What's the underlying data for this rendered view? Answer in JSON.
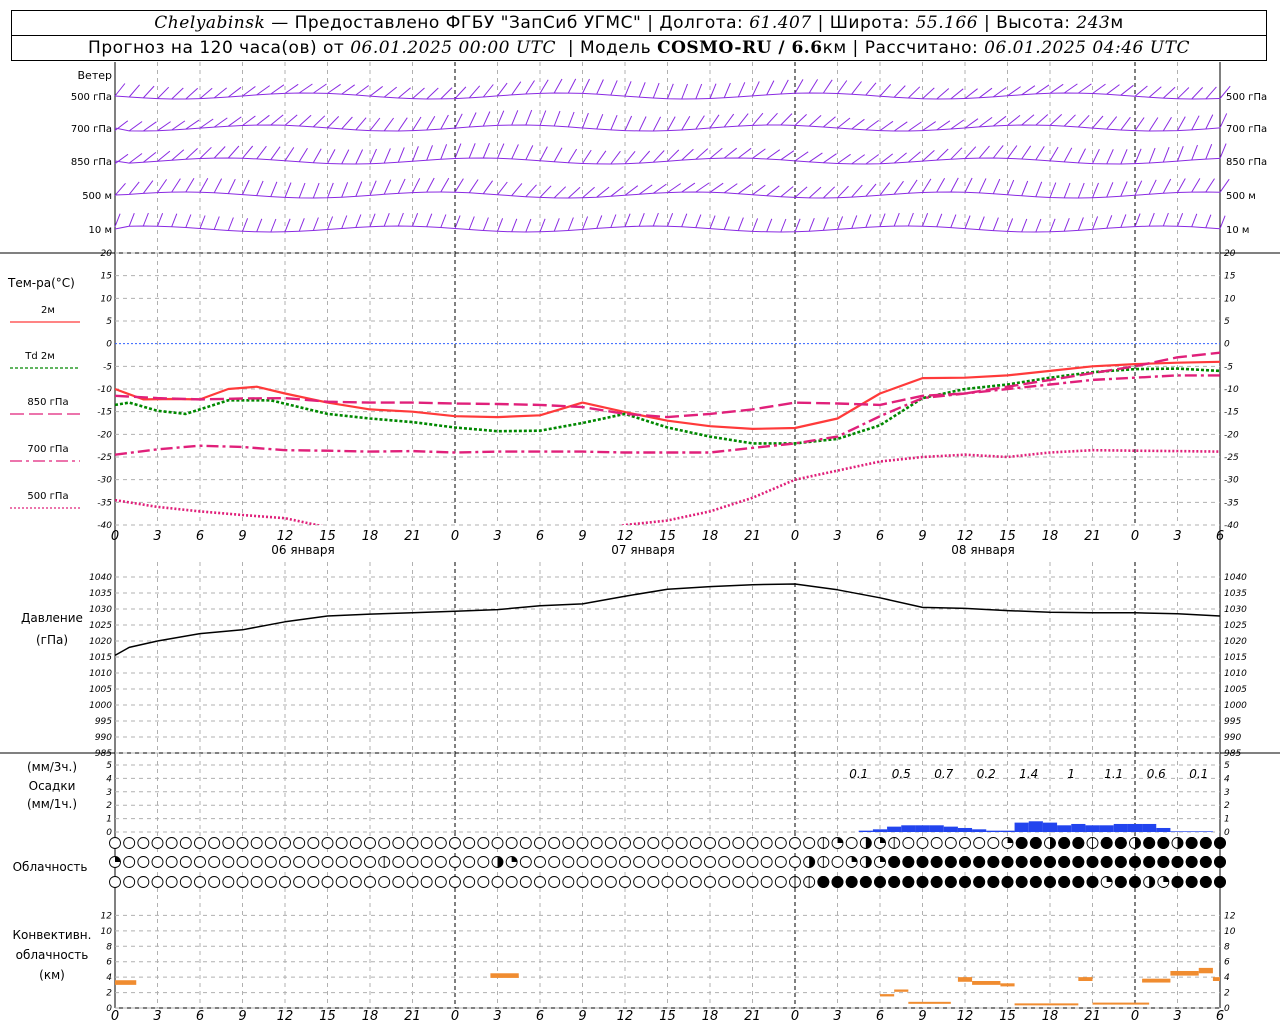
{
  "header": {
    "station": "Chelyabinsk",
    "provider": "— Предоставлено ФГБУ \"ЗапСиб УГМС\"",
    "lon_label": "Долгота:",
    "lon": "61.407",
    "lat_label": "Широта:",
    "lat": "55.166",
    "alt_label": "Высота:",
    "alt": "243",
    "alt_unit": "м",
    "forecast_label": "Прогноз на 120 часа(ов) от",
    "start": "06.01.2025 00:00 UTC",
    "model_label": "Модель",
    "model": "COSMO-RU / 6.6",
    "model_unit": "км",
    "calc_label": "Рассчитано:",
    "calc": "06.01.2025 04:46 UTC"
  },
  "colors": {
    "wind": "#8a2be2",
    "t2m": "#ff3a3a",
    "td2m": "#008800",
    "t850": "#e0207a",
    "t700": "#e0207a",
    "t500": "#e0207a",
    "zero_line": "#3060ff",
    "precip": "#2244ee",
    "conv": "#f08c30",
    "pressure": "#000000",
    "grid": "#b0b0b0"
  },
  "chart_data": [
    {
      "type": "wind_barbs",
      "panel_label": "Ветер",
      "levels": [
        {
          "label": "500 гПа"
        },
        {
          "label": "700 гПа"
        },
        {
          "label": "850 гПа"
        },
        {
          "label": "500 м"
        },
        {
          "label": "10 м"
        }
      ]
    },
    {
      "type": "line",
      "panel_label": "Тем-ра(°C)",
      "ylim": [
        -40,
        20
      ],
      "yticks": [
        20,
        15,
        10,
        5,
        0,
        -5,
        -10,
        -15,
        -20,
        -25,
        -30,
        -35,
        -40
      ],
      "xlabels": [
        "0",
        "3",
        "6",
        "9",
        "12",
        "15",
        "18",
        "21",
        "0",
        "3",
        "6",
        "9",
        "12",
        "15",
        "18",
        "21",
        "0",
        "3",
        "6",
        "9",
        "12",
        "15",
        "18",
        "21",
        "0",
        "3",
        "6"
      ],
      "day_labels": [
        {
          "hour": 12,
          "text": "06 января"
        },
        {
          "hour": 36,
          "text": "07 января"
        },
        {
          "hour": 60,
          "text": "08 января"
        }
      ],
      "series": [
        {
          "name": "2м",
          "key": "t2m",
          "x": [
            0,
            2,
            4,
            6,
            8,
            10,
            12,
            15,
            18,
            21,
            24,
            27,
            30,
            33,
            36,
            39,
            42,
            45,
            48,
            51,
            54,
            57,
            60,
            63,
            66,
            69,
            72,
            75,
            78
          ],
          "y": [
            -10,
            -12.3,
            -12.2,
            -12.3,
            -10,
            -9.5,
            -11,
            -13,
            -14.5,
            -15,
            -16,
            -16.2,
            -15.8,
            -13,
            -15.1,
            -17,
            -18.2,
            -18.8,
            -18.6,
            -16.5,
            -11,
            -7.6,
            -7.5,
            -7,
            -6,
            -5,
            -4.5,
            -4.2,
            -4
          ]
        },
        {
          "name": "Td 2м",
          "key": "td2m",
          "x": [
            0,
            1,
            3,
            5,
            8,
            11,
            15,
            18,
            21,
            24,
            27,
            30,
            33,
            36,
            39,
            42,
            45,
            48,
            51,
            54,
            57,
            60,
            63,
            66,
            69,
            72,
            75,
            78
          ],
          "y": [
            -13.5,
            -13,
            -14.8,
            -15.5,
            -12.5,
            -12.5,
            -15.5,
            -16.5,
            -17.3,
            -18.5,
            -19.3,
            -19.2,
            -17.5,
            -15.5,
            -18.5,
            -20.5,
            -22,
            -22,
            -21,
            -18,
            -12,
            -10,
            -9,
            -7.5,
            -6.3,
            -5.6,
            -5.5,
            -6
          ]
        },
        {
          "name": "850 гПа",
          "key": "t850",
          "x": [
            0,
            3,
            6,
            9,
            12,
            15,
            18,
            21,
            24,
            27,
            30,
            33,
            36,
            39,
            42,
            45,
            48,
            51,
            54,
            57,
            60,
            63,
            66,
            69,
            72,
            75,
            78
          ],
          "y": [
            -11.5,
            -12,
            -12.3,
            -12.1,
            -12,
            -12.8,
            -13,
            -13,
            -13.2,
            -13.3,
            -13.5,
            -14,
            -15.5,
            -16.2,
            -15.5,
            -14.5,
            -13,
            -13.2,
            -13.5,
            -11.5,
            -11,
            -9.5,
            -8,
            -6.5,
            -5,
            -3,
            -2
          ]
        },
        {
          "name": "700 гПа",
          "key": "t700",
          "x": [
            0,
            3,
            6,
            9,
            12,
            15,
            18,
            21,
            24,
            27,
            30,
            33,
            36,
            39,
            42,
            45,
            48,
            51,
            54,
            57,
            60,
            63,
            66,
            69,
            72,
            75,
            78
          ],
          "y": [
            -24.5,
            -23.3,
            -22.5,
            -22.8,
            -23.5,
            -23.6,
            -23.8,
            -23.7,
            -24,
            -23.8,
            -23.8,
            -23.8,
            -24,
            -24,
            -24,
            -23,
            -22,
            -20.5,
            -16,
            -12,
            -11,
            -10,
            -9,
            -8,
            -7.5,
            -7,
            -7
          ]
        },
        {
          "name": "500 гПа",
          "key": "t500",
          "x": [
            0,
            3,
            6,
            9,
            12,
            15,
            18,
            21,
            24,
            27,
            30,
            33,
            36,
            39,
            42,
            45,
            48,
            51,
            54,
            57,
            60,
            63,
            66,
            69,
            72,
            75,
            78
          ],
          "y": [
            -34.5,
            -36,
            -37,
            -37.8,
            -38.5,
            -40.5,
            -42,
            -43,
            -44,
            -44.5,
            -44,
            -42,
            -40,
            -39,
            -37,
            -34,
            -30,
            -28,
            -26,
            -25,
            -24.5,
            -25,
            -24,
            -23.5,
            -23.6,
            -23.7,
            -23.8
          ]
        }
      ]
    },
    {
      "type": "line",
      "panel_label": "Давление",
      "panel_unit": "(гПа)",
      "ylim": [
        985,
        1040
      ],
      "yticks": [
        1040,
        1035,
        1030,
        1025,
        1020,
        1015,
        1010,
        1005,
        1000,
        995,
        990,
        985
      ],
      "series": [
        {
          "key": "pressure",
          "x": [
            0,
            1,
            3,
            6,
            9,
            12,
            15,
            18,
            21,
            24,
            27,
            30,
            33,
            36,
            39,
            42,
            45,
            48,
            51,
            54,
            57,
            60,
            63,
            66,
            69,
            72,
            75,
            78
          ],
          "y": [
            1015.5,
            1018,
            1020,
            1022.3,
            1023.5,
            1026,
            1027.8,
            1028.4,
            1028.8,
            1029.3,
            1029.8,
            1031,
            1031.6,
            1034,
            1036.2,
            1037,
            1037.6,
            1037.8,
            1036,
            1033.5,
            1030.5,
            1030.2,
            1029.5,
            1029,
            1028.8,
            1028.8,
            1028.5,
            1027.8
          ]
        }
      ]
    },
    {
      "type": "bar",
      "panel_label_top": "(мм/3ч.)",
      "panel_label": "Осадки",
      "panel_unit": "(мм/1ч.)",
      "ylim": [
        0,
        5
      ],
      "yticks": [
        5,
        4,
        3,
        2,
        1,
        0
      ],
      "hours": [
        53,
        54,
        55,
        56,
        57,
        58,
        59,
        60,
        61,
        62,
        63,
        64,
        65,
        66,
        67,
        68,
        69,
        70,
        71,
        72,
        73,
        74,
        75,
        76,
        77
      ],
      "hourly": [
        0.1,
        0.2,
        0.4,
        0.5,
        0.5,
        0.5,
        0.4,
        0.3,
        0.2,
        0.1,
        0.1,
        0.7,
        0.8,
        0.7,
        0.5,
        0.6,
        0.5,
        0.5,
        0.6,
        0.6,
        0.6,
        0.3,
        0.05,
        0.05,
        0.05
      ],
      "three_hour": [
        {
          "hour": 52.5,
          "text": "0.1"
        },
        {
          "hour": 55.5,
          "text": "0.5"
        },
        {
          "hour": 58.5,
          "text": "0.7"
        },
        {
          "hour": 61.5,
          "text": "0.2"
        },
        {
          "hour": 64.5,
          "text": "1.4"
        },
        {
          "hour": 67.5,
          "text": "1"
        },
        {
          "hour": 70.5,
          "text": "1.1"
        },
        {
          "hour": 73.5,
          "text": "0.6"
        },
        {
          "hour": 76.5,
          "text": "0.1"
        }
      ]
    },
    {
      "type": "cloud_symbols",
      "panel_label": "Облачность",
      "rows": [
        [
          [
            0,
            0
          ],
          [
            50,
            1
          ],
          [
            51,
            2
          ],
          [
            52,
            0
          ],
          [
            53,
            3
          ],
          [
            54,
            2
          ],
          [
            55,
            1
          ],
          [
            56,
            0
          ],
          [
            63,
            2
          ],
          [
            64,
            4
          ],
          [
            66,
            3
          ],
          [
            67,
            4
          ],
          [
            68,
            4
          ],
          [
            69,
            1
          ],
          [
            70,
            4
          ],
          [
            71,
            4
          ],
          [
            72,
            3
          ],
          [
            73,
            4
          ],
          [
            74,
            4
          ],
          [
            75,
            3
          ],
          [
            76,
            4
          ]
        ],
        [
          [
            0,
            2
          ],
          [
            1,
            0
          ],
          [
            19,
            1
          ],
          [
            20,
            0
          ],
          [
            27,
            3
          ],
          [
            28,
            2
          ],
          [
            29,
            0
          ],
          [
            49,
            3
          ],
          [
            50,
            1
          ],
          [
            51,
            0
          ],
          [
            52,
            2
          ],
          [
            53,
            3
          ],
          [
            54,
            2
          ],
          [
            55,
            4
          ],
          [
            78,
            4
          ]
        ],
        [
          [
            0,
            0
          ],
          [
            48,
            1
          ],
          [
            49,
            1
          ],
          [
            50,
            4
          ],
          [
            70,
            2
          ],
          [
            71,
            4
          ],
          [
            73,
            3
          ],
          [
            74,
            2
          ],
          [
            75,
            4
          ],
          [
            78,
            4
          ]
        ]
      ]
    },
    {
      "type": "bar",
      "panel_label": "Конвективн. облачность (км)",
      "ylim": [
        0,
        14
      ],
      "yticks": [
        12,
        10,
        8,
        6,
        4,
        2,
        0
      ],
      "segments": [
        {
          "x0": 0,
          "x1": 1.5,
          "y0": 3,
          "y1": 3.6
        },
        {
          "x0": 26.5,
          "x1": 28.5,
          "y0": 3.9,
          "y1": 4.5
        },
        {
          "x0": 54,
          "x1": 55,
          "y0": 1.5,
          "y1": 1.8
        },
        {
          "x0": 55,
          "x1": 56,
          "y0": 2.1,
          "y1": 2.4
        },
        {
          "x0": 56,
          "x1": 59,
          "y0": 0.6,
          "y1": 0.8
        },
        {
          "x0": 59.5,
          "x1": 60.5,
          "y0": 3.4,
          "y1": 4
        },
        {
          "x0": 60.5,
          "x1": 62.5,
          "y0": 3,
          "y1": 3.5
        },
        {
          "x0": 62.5,
          "x1": 63.5,
          "y0": 2.8,
          "y1": 3.2
        },
        {
          "x0": 63.5,
          "x1": 68,
          "y0": 0.5,
          "y1": 0.6
        },
        {
          "x0": 68,
          "x1": 69,
          "y0": 3.5,
          "y1": 4
        },
        {
          "x0": 69,
          "x1": 73,
          "y0": 0.6,
          "y1": 0.7
        },
        {
          "x0": 72.5,
          "x1": 74.5,
          "y0": 3.3,
          "y1": 3.8
        },
        {
          "x0": 74.5,
          "x1": 76.5,
          "y0": 4.2,
          "y1": 4.8
        },
        {
          "x0": 76.5,
          "x1": 77.5,
          "y0": 4.5,
          "y1": 5.2
        },
        {
          "x0": 77.5,
          "x1": 78,
          "y0": 3.5,
          "y1": 4
        }
      ]
    }
  ]
}
